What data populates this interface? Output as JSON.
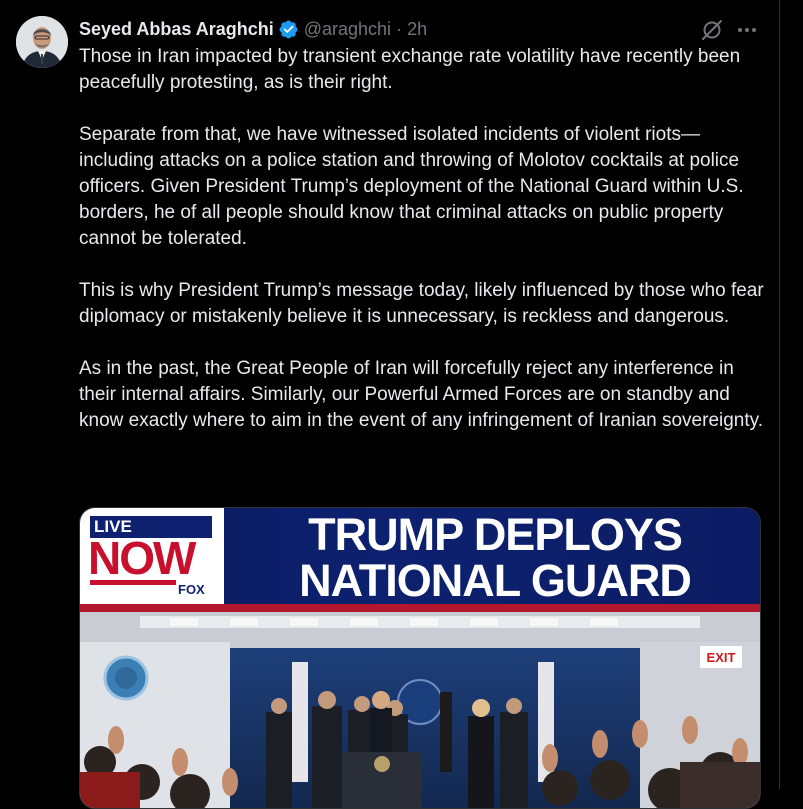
{
  "tweet": {
    "author": {
      "name": "Seyed Abbas Araghchi",
      "handle": "@araghchi",
      "verified": true
    },
    "separator": "·",
    "timestamp": "2h",
    "paragraphs": [
      "Those in Iran impacted by transient exchange rate volatility have recently been peacefully protesting, as is their right.",
      "Separate from that, we have witnessed isolated incidents of violent riots—including attacks on a police station and throwing of Molotov cocktails at police officers. Given President Trump’s deployment of the National Guard within U.S. borders, he of all people should know that criminal attacks on public property cannot be tolerated.",
      "This is why President Trump’s message today, likely influenced by those who fear diplomacy or mistakenly believe it is unnecessary, is reckless and dangerous.",
      "As in the past, the Great People of Iran will forcefully reject any interference in their internal affairs. Similarly, our Powerful Armed Forces are on standby and know exactly where to aim in the event of any infringement of Iranian sovereignty."
    ],
    "media": {
      "logo_live": "LIVE",
      "logo_now": "NOW",
      "logo_network": "FOX",
      "headline_line1": "TRUMP DEPLOYS",
      "headline_line2": "NATIONAL GUARD",
      "podium_sign": "EXIT"
    }
  },
  "icons": {
    "verified": "verified-badge-icon",
    "grok": "grok-icon",
    "more": "more-icon"
  },
  "colors": {
    "background": "#000000",
    "text_primary": "#e7e9ea",
    "text_secondary": "#71767b",
    "verified_blue": "#1d9bf0",
    "divider": "#2f3336",
    "banner_navy": "#0d2170",
    "banner_red": "#c8102e"
  }
}
